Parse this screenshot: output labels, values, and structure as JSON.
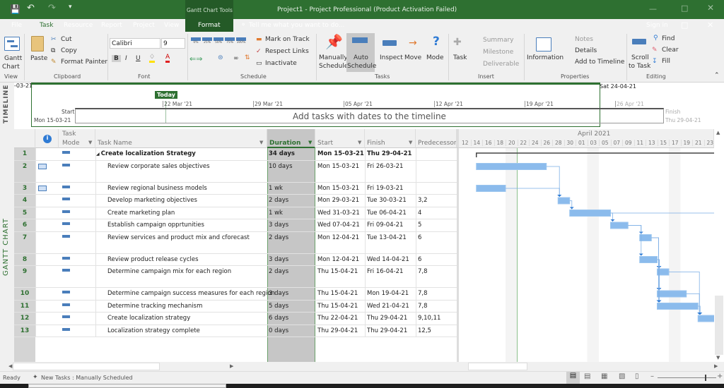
{
  "title": {
    "app_title": "Project1 - Project Professional (Product Activation Failed)",
    "context_group": "Gantt Chart Tools"
  },
  "tabs": [
    "File",
    "Task",
    "Resource",
    "Report",
    "Project",
    "View",
    "Format"
  ],
  "tell_me": "Tell me what you want to do...",
  "sign_in": "Sign in",
  "ribbon": {
    "gantt_chart": "Gantt",
    "gantt_chart2": "Chart",
    "paste": "Paste",
    "cut": "Cut",
    "copy": "Copy",
    "format_painter": "Format Painter",
    "font_name": "Calibri",
    "font_size": "9",
    "bold": "B",
    "italic": "I",
    "underline": "U",
    "pct": [
      "0%",
      "25%",
      "50%",
      "75%",
      "100%"
    ],
    "mark_on_track": "Mark on Track",
    "respect_links": "Respect Links",
    "inactivate": "Inactivate",
    "manually": "Manually",
    "schedule": "Schedule",
    "auto": "Auto",
    "schedule2": "Schedule",
    "inspect": "Inspect",
    "move": "Move",
    "mode": "Mode",
    "task": "Task",
    "summary": "Summary",
    "milestone": "Milestone",
    "deliverable": "Deliverable",
    "information": "Information",
    "notes": "Notes",
    "details": "Details",
    "add_to_timeline": "Add to Timeline",
    "scroll": "Scroll",
    "to_task": "to Task",
    "find": "Find",
    "clear": "Clear",
    "fill": "Fill",
    "groups": [
      "View",
      "Clipboard",
      "Font",
      "Schedule",
      "Tasks",
      "Insert",
      "Properties",
      "Editing"
    ]
  },
  "timeline": {
    "label": "TIMELINE",
    "left_date": "-03-21",
    "right_date": "Sat 24-04-21",
    "today": "Today",
    "ticks": [
      "22 Mar '21",
      "29 Mar '21",
      "05 Apr '21",
      "12 Apr '21",
      "19 Apr '21",
      "26 Apr '21"
    ],
    "start_label": "Start",
    "start_date": "Mon 15-03-21",
    "finish_label": "Finish",
    "finish_date": "Thu 29-04-21",
    "placeholder": "Add tasks with dates to the timeline"
  },
  "view_label": "GANTT CHART",
  "columns": {
    "mode1": "Task",
    "mode2": "Mode",
    "name": "Task Name",
    "duration": "Duration",
    "start": "Start",
    "finish": "Finish",
    "predecessors": "Predecessors"
  },
  "gantt_header": {
    "month": "April 2021",
    "days": [
      "12",
      "14",
      "16",
      "18",
      "20",
      "22",
      "24",
      "26",
      "28",
      "30",
      "01",
      "03",
      "05",
      "07",
      "09",
      "11",
      "13",
      "15",
      "17",
      "19",
      "21",
      "23"
    ]
  },
  "tasks": [
    {
      "id": "1",
      "name": "Create localization Strategy",
      "duration": "34 days",
      "start": "Mon 15-03-21",
      "finish": "Thu 29-04-21",
      "pred": "",
      "summary": true,
      "ind": false,
      "tall": false
    },
    {
      "id": "2",
      "name": "Review corporate sales objectives",
      "duration": "10 days",
      "start": "Mon 15-03-21",
      "finish": "Fri 26-03-21",
      "pred": "",
      "ind": true,
      "tall": true
    },
    {
      "id": "3",
      "name": "Review regional business models",
      "duration": "1 wk",
      "start": "Mon 15-03-21",
      "finish": "Fri 19-03-21",
      "pred": "",
      "ind": true,
      "tall": false
    },
    {
      "id": "4",
      "name": "Develop marketing objectives",
      "duration": "2 days",
      "start": "Mon 29-03-21",
      "finish": "Tue 30-03-21",
      "pred": "3,2",
      "tall": false
    },
    {
      "id": "5",
      "name": "Create marketing plan",
      "duration": "1 wk",
      "start": "Wed 31-03-21",
      "finish": "Tue 06-04-21",
      "pred": "4",
      "tall": false
    },
    {
      "id": "6",
      "name": "Establish campaign opprtunities",
      "duration": "3 days",
      "start": "Wed 07-04-21",
      "finish": "Fri 09-04-21",
      "pred": "5",
      "tall": false
    },
    {
      "id": "7",
      "name": "Review services and product mix and cforecast",
      "duration": "2 days",
      "start": "Mon 12-04-21",
      "finish": "Tue 13-04-21",
      "pred": "6",
      "tall": true
    },
    {
      "id": "8",
      "name": "Review product release cycles",
      "duration": "3 days",
      "start": "Mon 12-04-21",
      "finish": "Wed 14-04-21",
      "pred": "6",
      "tall": false
    },
    {
      "id": "9",
      "name": "Determine campaign mix for each region",
      "duration": "2 days",
      "start": "Thu 15-04-21",
      "finish": "Fri 16-04-21",
      "pred": "7,8",
      "tall": true
    },
    {
      "id": "10",
      "name": "Determine campaign success measures for each region",
      "duration": "3 days",
      "start": "Thu 15-04-21",
      "finish": "Mon 19-04-21",
      "pred": "7,8",
      "tall": false
    },
    {
      "id": "11",
      "name": "Determine tracking mechanism",
      "duration": "5 days",
      "start": "Thu 15-04-21",
      "finish": "Wed 21-04-21",
      "pred": "7,8",
      "tall": false
    },
    {
      "id": "12",
      "name": "Create localization strategy",
      "duration": "6 days",
      "start": "Thu 22-04-21",
      "finish": "Thu 29-04-21",
      "pred": "9,10,11",
      "tall": false
    },
    {
      "id": "13",
      "name": "Localization strategy complete",
      "duration": "0 days",
      "start": "Thu 29-04-21",
      "finish": "Thu 29-04-21",
      "pred": "12,5",
      "tall": false
    }
  ],
  "status": {
    "ready": "Ready",
    "new_tasks": "New Tasks : Manually Scheduled"
  },
  "colors": {
    "brand": "#2e7031",
    "bar": "#8bbbec",
    "link": "#2f7bd4"
  }
}
